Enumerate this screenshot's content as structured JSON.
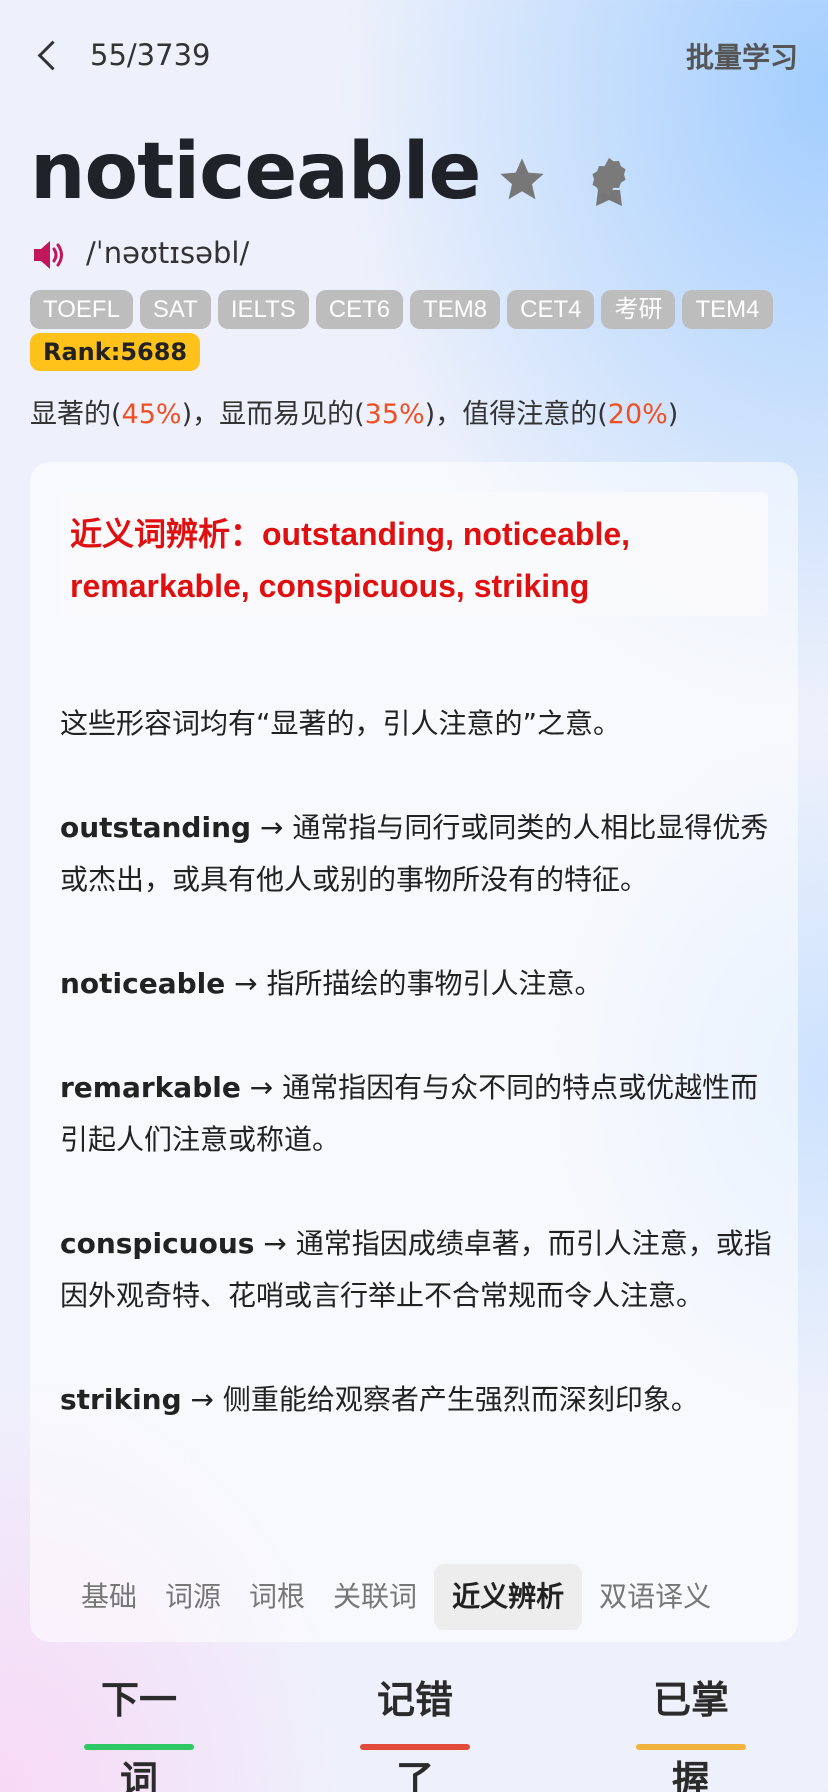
{
  "header": {
    "progress": "55/3739",
    "batch_label": "批量学习"
  },
  "word": {
    "headword": "noticeable",
    "phonetic": "/ˈnəʊtɪsəbl/",
    "tags": [
      "TOEFL",
      "SAT",
      "IELTS",
      "CET6",
      "TEM8",
      "CET4",
      "考研",
      "TEM4"
    ],
    "rank": "Rank:5688",
    "meanings": [
      {
        "text": "显著的",
        "pct": "45%",
        "sep": "，"
      },
      {
        "text": "显而易见的",
        "pct": "35%",
        "sep": "，"
      },
      {
        "text": "值得注意的",
        "pct": "20%",
        "sep": ""
      }
    ]
  },
  "synonyms": {
    "heading": "近义词辨析：outstanding, noticeable, remarkable, conspicuous, striking",
    "intro": "这些形容词均有“显著的，引人注意的”之意。",
    "entries": [
      {
        "word": "outstanding",
        "desc": " → 通常指与同行或同类的人相比显得优秀或杰出，或具有他人或别的事物所没有的特征。"
      },
      {
        "word": "noticeable",
        "desc": " → 指所描绘的事物引人注意。"
      },
      {
        "word": "remarkable",
        "desc": " → 通常指因有与众不同的特点或优越性而引起人们注意或称道。"
      },
      {
        "word": "conspicuous",
        "desc": " → 通常指因成绩卓著，而引人注意，或指因外观奇特、花哨或言行举止不合常规而令人注意。"
      },
      {
        "word": "striking",
        "desc": " → 侧重能给观察者产生强烈而深刻印象。"
      }
    ]
  },
  "tabs": [
    "基础",
    "词源",
    "词根",
    "关联词",
    "近义辨析",
    "双语译义"
  ],
  "active_tab": "近义辨析",
  "actions": {
    "next": "下一词",
    "wrong": "记错了",
    "mastered": "已掌握"
  },
  "colors": {
    "next_bar": "#2ec866",
    "wrong_bar": "#e24a3b",
    "mastered_bar": "#f2b33d",
    "percent": "#f04e23",
    "heading": "#e01010",
    "rank_bg": "#ffc21a",
    "speaker": "#c2185b"
  },
  "icons": {
    "back": "chevron-left-icon",
    "star": "star-icon",
    "badge": "award-badge-icon",
    "speaker": "speaker-icon"
  }
}
